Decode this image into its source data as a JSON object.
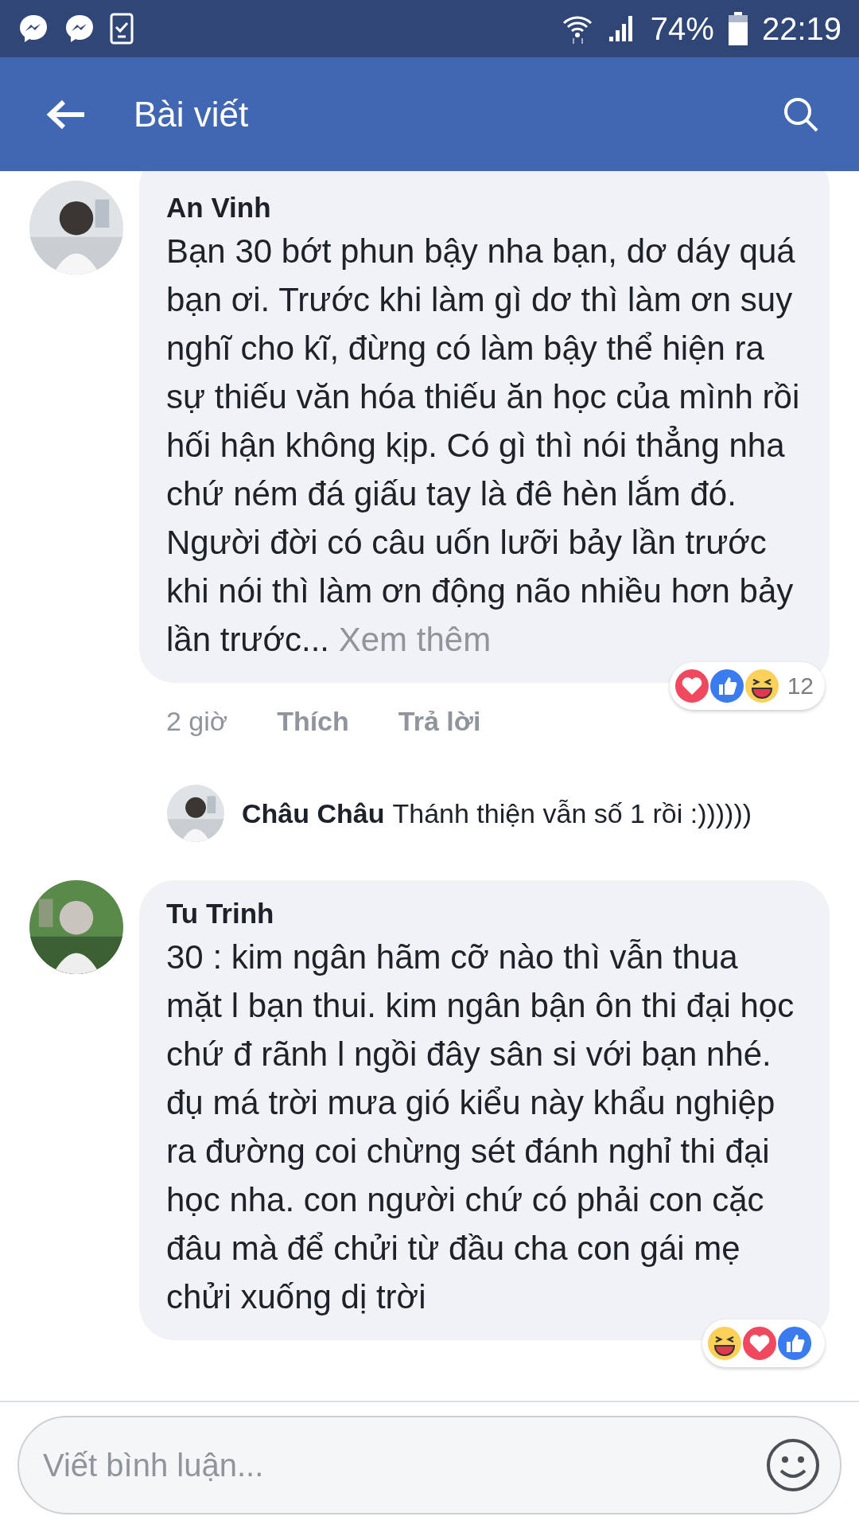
{
  "status_bar": {
    "battery": "74%",
    "time": "22:19"
  },
  "header": {
    "title": "Bài viết"
  },
  "comments": [
    {
      "author": "An Vinh",
      "text": "Bạn 30 bớt phun bậy nha bạn, dơ dáy quá bạn ơi. Trước khi làm gì dơ thì làm ơn suy nghĩ cho kĩ, đừng có làm bậy thể hiện ra sự thiếu văn hóa thiếu ăn học của mình rồi hối hận không kịp. Có gì thì nói thẳng nha chứ ném đá giấu tay là đê hèn lắm đó. Người đời có câu uốn lưỡi bảy lần trước khi nói thì làm ơn động não nhiều hơn bảy lần trước...",
      "see_more": "Xem thêm",
      "time": "2 giờ",
      "actions": [
        "Thích",
        "Trả lời"
      ],
      "reactions": [
        {
          "kind": "love"
        },
        {
          "kind": "like"
        },
        {
          "kind": "haha"
        }
      ],
      "reaction_count": "12",
      "replies": [
        {
          "author": "Châu Châu",
          "text": "Thánh thiện vẫn số 1 rồi :))))))"
        }
      ]
    },
    {
      "author": "Tu Trinh",
      "text": "30 : kim ngân hãm cỡ nào thì vẫn thua mặt l bạn thui. kim ngân bận ôn thi đại học chứ đ rãnh l ngồi đây sân si với bạn nhé. đụ má trời mưa gió kiểu này khẩu nghiệp ra đường coi chừng sét đánh nghỉ thi đại học nha. con người chứ có phải con cặc đâu mà để chửi từ đầu cha con gái mẹ chửi xuống  dị trời",
      "reactions": [
        {
          "kind": "haha"
        },
        {
          "kind": "love"
        },
        {
          "kind": "like"
        }
      ]
    }
  ],
  "composer": {
    "placeholder": "Viết bình luận..."
  }
}
